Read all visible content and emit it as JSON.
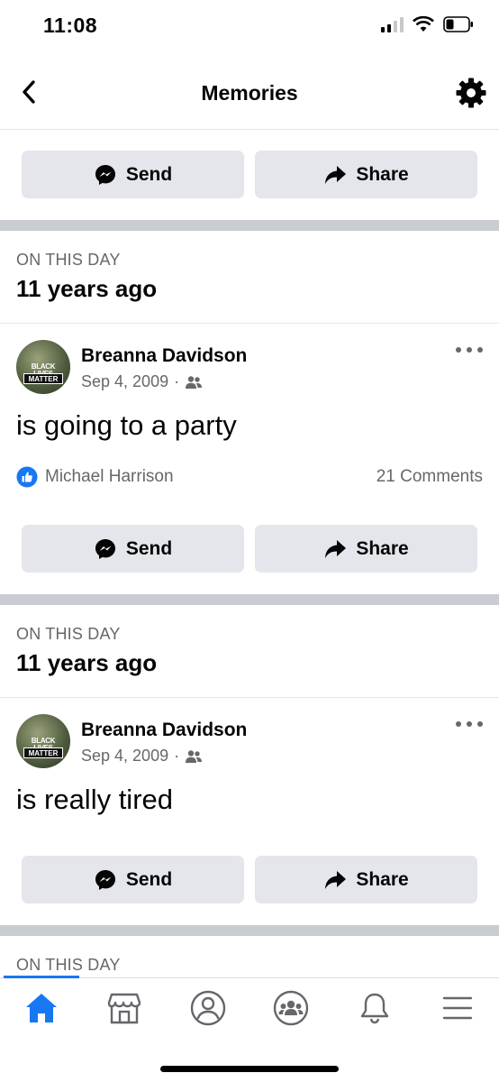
{
  "status": {
    "time": "11:08"
  },
  "header": {
    "title": "Memories"
  },
  "top_actions": {
    "send_label": "Send",
    "share_label": "Share"
  },
  "memories": [
    {
      "label": "ON THIS DAY",
      "ago": "11 years ago",
      "author": "Breanna Davidson",
      "date": "Sep 4, 2009",
      "audience_icon": "friends-icon",
      "text": "is going to a party",
      "reactor": "Michael Harrison",
      "comments": "21 Comments",
      "send_label": "Send",
      "share_label": "Share"
    },
    {
      "label": "ON THIS DAY",
      "ago": "11 years ago",
      "author": "Breanna Davidson",
      "date": "Sep 4, 2009",
      "audience_icon": "friends-icon",
      "text": "is really tired",
      "send_label": "Send",
      "share_label": "Share"
    },
    {
      "label": "ON THIS DAY"
    }
  ],
  "avatar_text": {
    "line1": "BLACK LIVES",
    "line2": "MATTER"
  },
  "tabs": [
    {
      "name": "home",
      "icon": "home-icon",
      "active": true
    },
    {
      "name": "marketplace",
      "icon": "marketplace-icon"
    },
    {
      "name": "profile",
      "icon": "profile-icon"
    },
    {
      "name": "groups",
      "icon": "groups-icon"
    },
    {
      "name": "notifications",
      "icon": "bell-icon"
    },
    {
      "name": "menu",
      "icon": "menu-icon"
    }
  ],
  "colors": {
    "accent": "#1877f2",
    "button_bg": "#e4e6eb",
    "separator": "#c9ccd1",
    "secondary_text": "#65676b"
  }
}
